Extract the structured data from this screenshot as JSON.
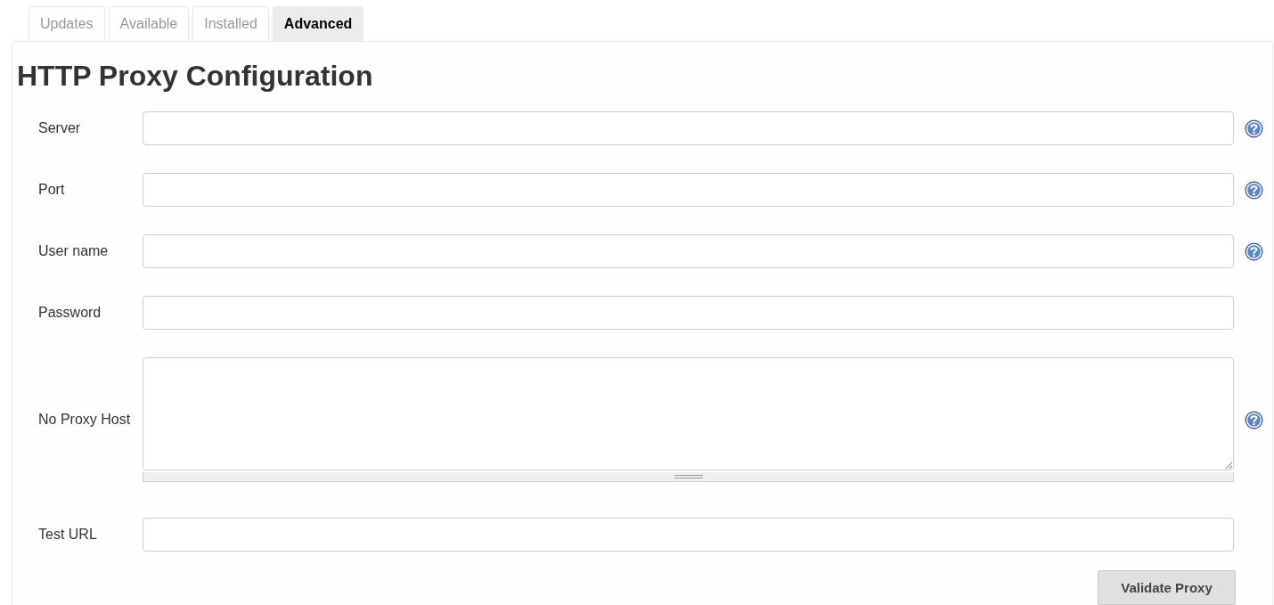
{
  "tabs": [
    {
      "label": "Updates",
      "selected": false
    },
    {
      "label": "Available",
      "selected": false
    },
    {
      "label": "Installed",
      "selected": false
    },
    {
      "label": "Advanced",
      "selected": true
    }
  ],
  "section": {
    "title": "HTTP Proxy Configuration",
    "fields": [
      {
        "label": "Server",
        "kind": "input",
        "help": true
      },
      {
        "label": "Port",
        "kind": "input",
        "help": true
      },
      {
        "label": "User name",
        "kind": "input",
        "help": true
      },
      {
        "label": "Password",
        "kind": "input",
        "help": false
      },
      {
        "label": "No Proxy Host",
        "kind": "textarea",
        "help": true
      },
      {
        "label": "Test URL",
        "kind": "input",
        "help": false
      }
    ],
    "button": "Validate Proxy"
  }
}
